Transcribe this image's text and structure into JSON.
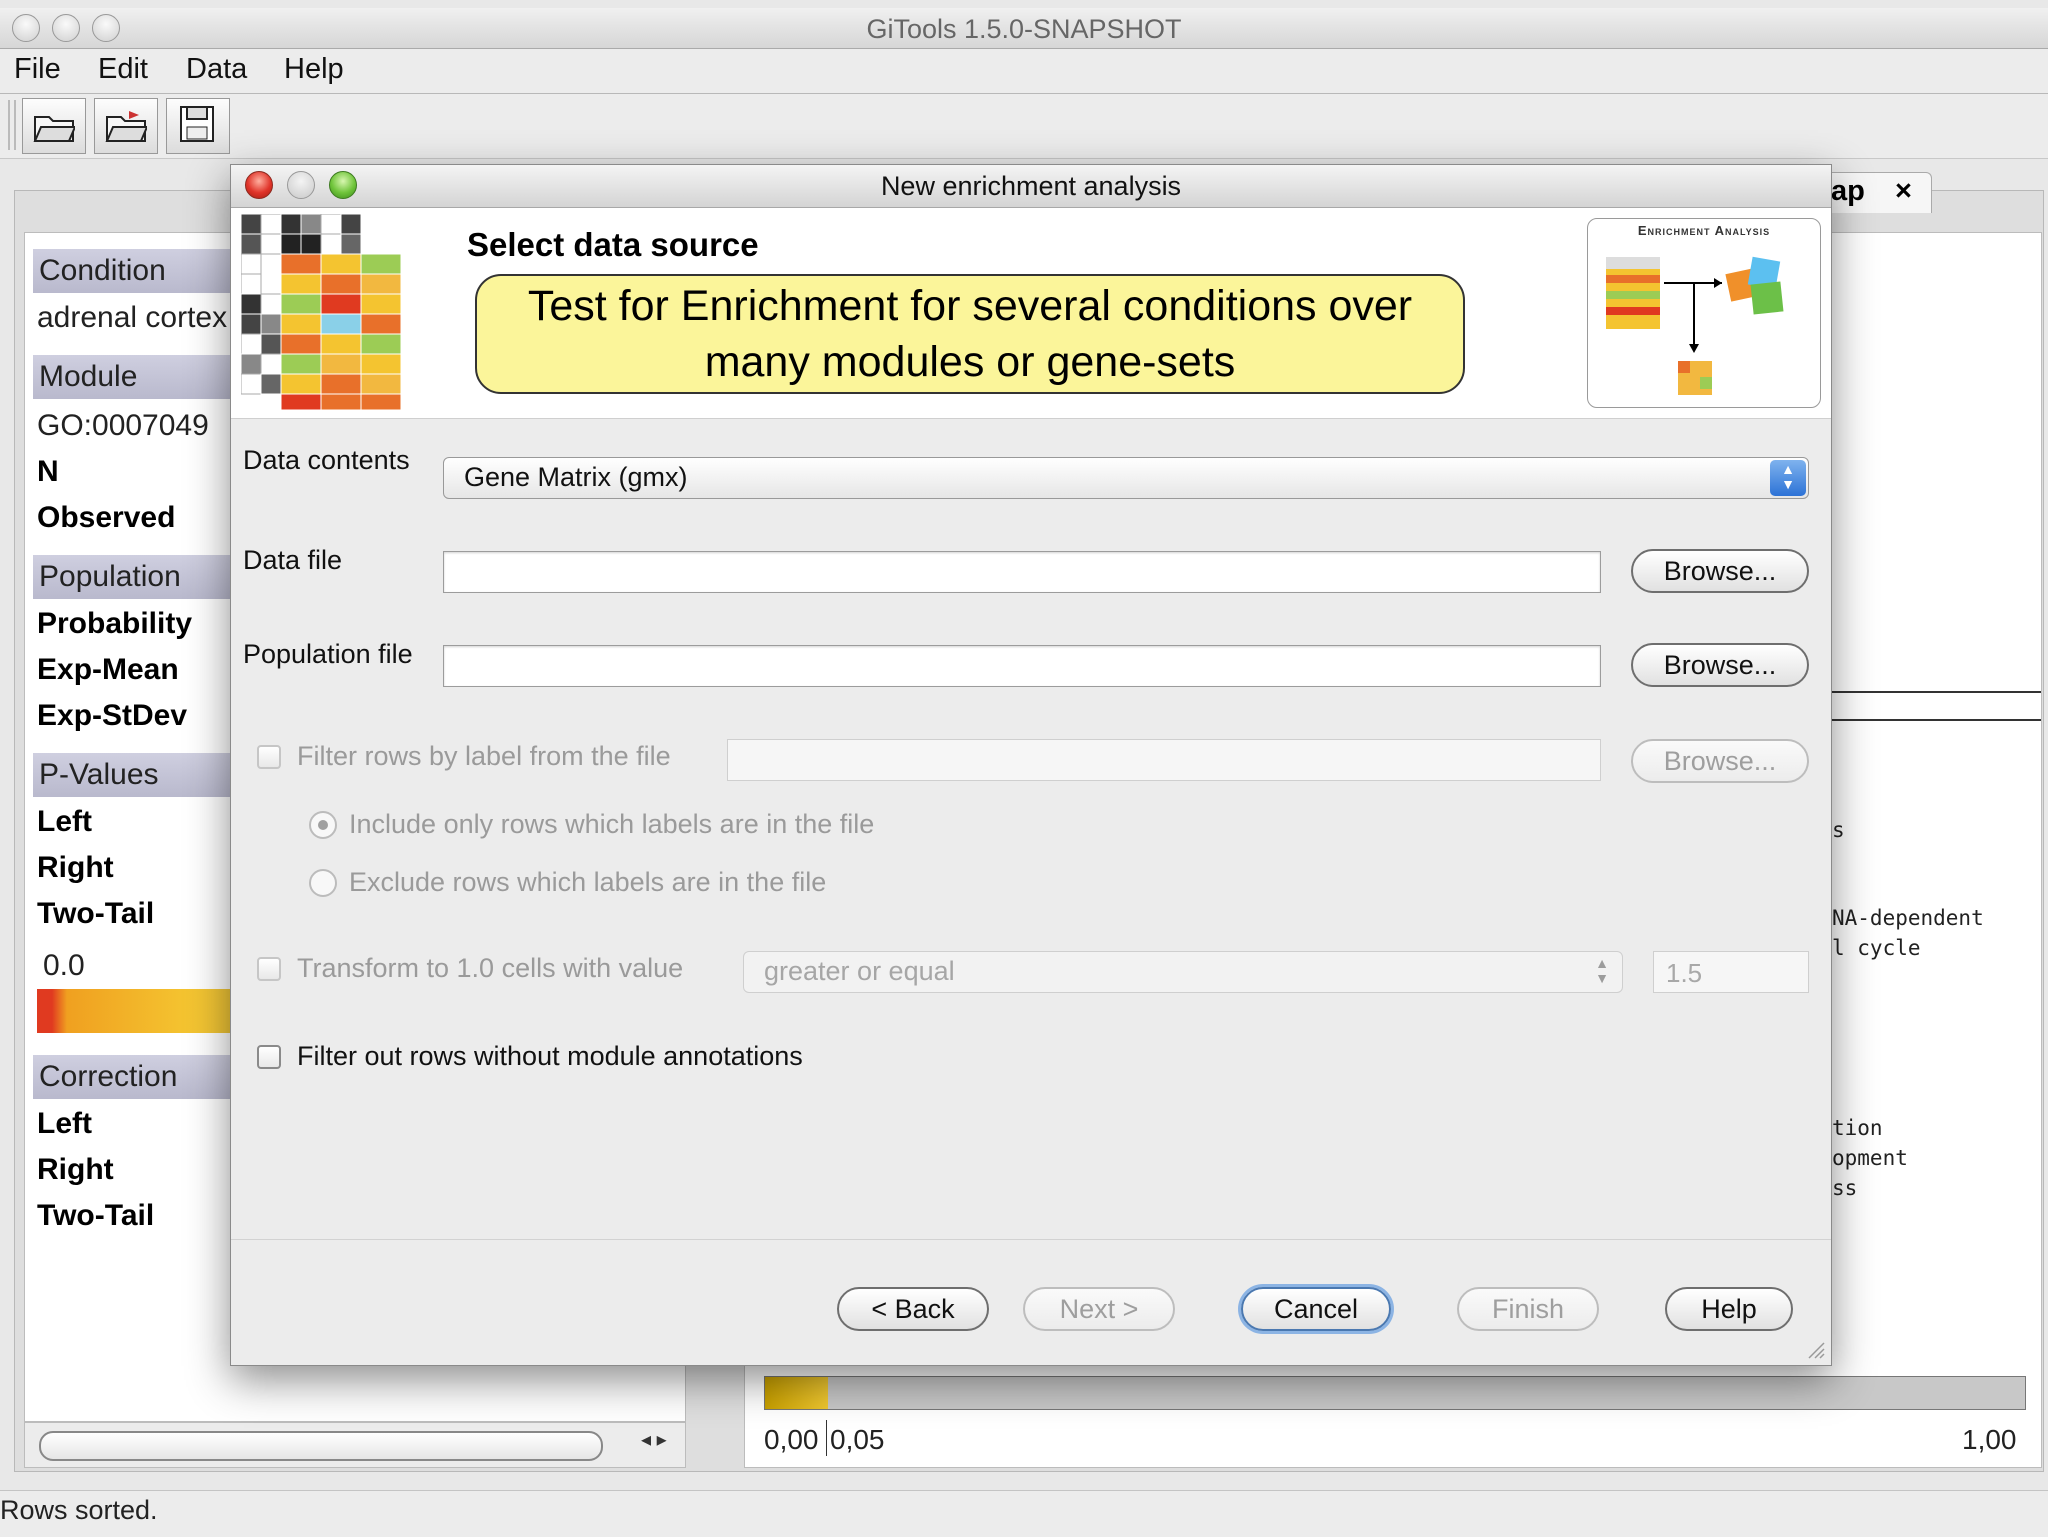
{
  "app": {
    "title": "GiTools 1.5.0-SNAPSHOT"
  },
  "menu": [
    "File",
    "Edit",
    "Data",
    "Help"
  ],
  "toolbar": {
    "icons": [
      "open-folder-icon",
      "open-recent-icon",
      "save-icon"
    ]
  },
  "left_panel": {
    "condition_header": "Condition",
    "condition_value": "adrenal cortex",
    "module_header": "Module",
    "module_value": "GO:0007049",
    "n_label": "N",
    "observed_label": "Observed",
    "population_header": "Population",
    "probability_label": "Probability",
    "exp_mean_label": "Exp-Mean",
    "exp_stdev_label": "Exp-StDev",
    "pvalues_header": "P-Values",
    "left_label": "Left",
    "right_label": "Right",
    "two_tail_label": "Two-Tail",
    "scale_value": "0.0",
    "correction_header": "Correction",
    "corr_left_label": "Left",
    "corr_right_label": "Right",
    "corr_two_tail_label": "Two-Tail"
  },
  "right_panel": {
    "tab_label": "ap",
    "tab_close": "×",
    "text_lines": [
      "s",
      "NA-dependent",
      "l cycle",
      "tion",
      "opment",
      "ss"
    ],
    "scale_labels": [
      "0,00",
      "0,05",
      "1,00"
    ],
    "scale_fill_fraction": 0.05
  },
  "status": {
    "text": "Rows sorted."
  },
  "dialog": {
    "title": "New enrichment analysis",
    "heading": "Select data source",
    "callout_line1": "Test for Enrichment for several conditions over",
    "callout_line2": "many modules or gene-sets",
    "logo_caption": "Enrichment Analysis",
    "data_contents_label": "Data contents",
    "data_contents_value": "Gene Matrix (gmx)",
    "data_file_label": "Data file",
    "data_file_value": "",
    "population_file_label": "Population file",
    "population_file_value": "",
    "browse_label": "Browse...",
    "filter_rows_label": "Filter rows by label from the file",
    "include_only_label": "Include only rows which labels are in the file",
    "exclude_label": "Exclude rows which labels are in the file",
    "transform_label": "Transform to 1.0 cells with value",
    "transform_condition": "greater or equal",
    "transform_value": "1.5",
    "filter_out_label": "Filter out rows without module annotations",
    "back_label": "< Back",
    "next_label": "Next >",
    "cancel_label": "Cancel",
    "finish_label": "Finish",
    "help_label": "Help"
  },
  "colors": {
    "callout_bg": "#fbf59a",
    "section_header": "#c4c4d8",
    "heatmap_orange": "#e8702a",
    "heatmap_yellow": "#f4c430",
    "focus_blue": "#4a78b0"
  }
}
